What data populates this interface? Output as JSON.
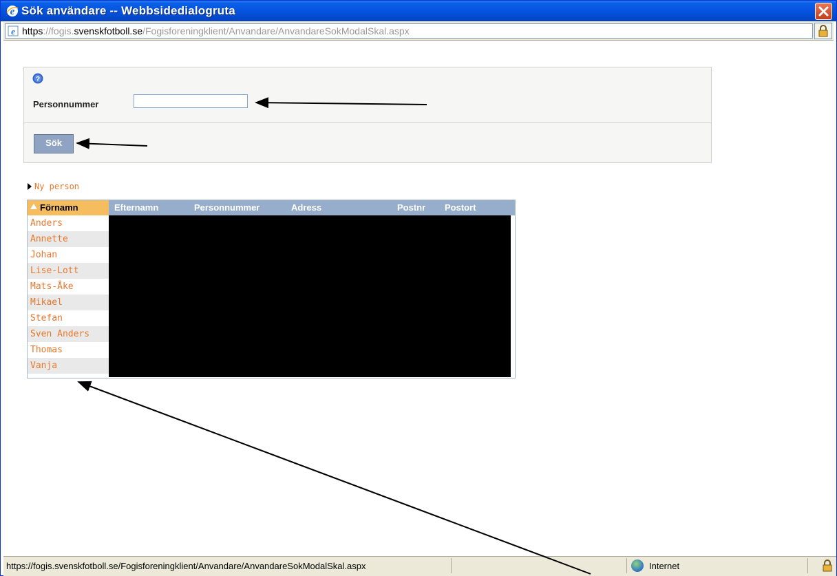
{
  "window": {
    "title": "Sök användare -- Webbsidedialogruta",
    "close_label": "×"
  },
  "address": {
    "scheme": "https",
    "sep1": "://fogis.",
    "domain": "svenskfotboll.se",
    "path": "/Fogisforeningklient/Anvandare/AnvandareSokModalSkal.aspx"
  },
  "search": {
    "help_icon": "help-icon",
    "personnummer_label": "Personnummer",
    "personnummer_value": "",
    "search_button": "Sök"
  },
  "new_person_link": "Ny person",
  "results_grid": {
    "columns": [
      "Förnamn",
      "Efternamn",
      "Personnummer",
      "Adress",
      "Postnr",
      "Postort"
    ],
    "sorted_column": "Förnamn",
    "first_names": [
      "Anders",
      "Annette",
      "Johan",
      "Lise-Lott",
      "Mats-Åke",
      "Mikael",
      "Stefan",
      "Sven Anders",
      "Thomas",
      "Vanja"
    ],
    "other_columns_redacted": true
  },
  "statusbar": {
    "url": "https://fogis.svenskfotboll.se/Fogisforeningklient/Anvandare/AnvandareSokModalSkal.aspx",
    "zone": "Internet"
  },
  "colors": {
    "titlebar": "#0653de",
    "link_orange": "#e8772c",
    "grid_header": "#96aecb",
    "sorted_header": "#f6bd5f",
    "button": "#8fa3c2"
  }
}
